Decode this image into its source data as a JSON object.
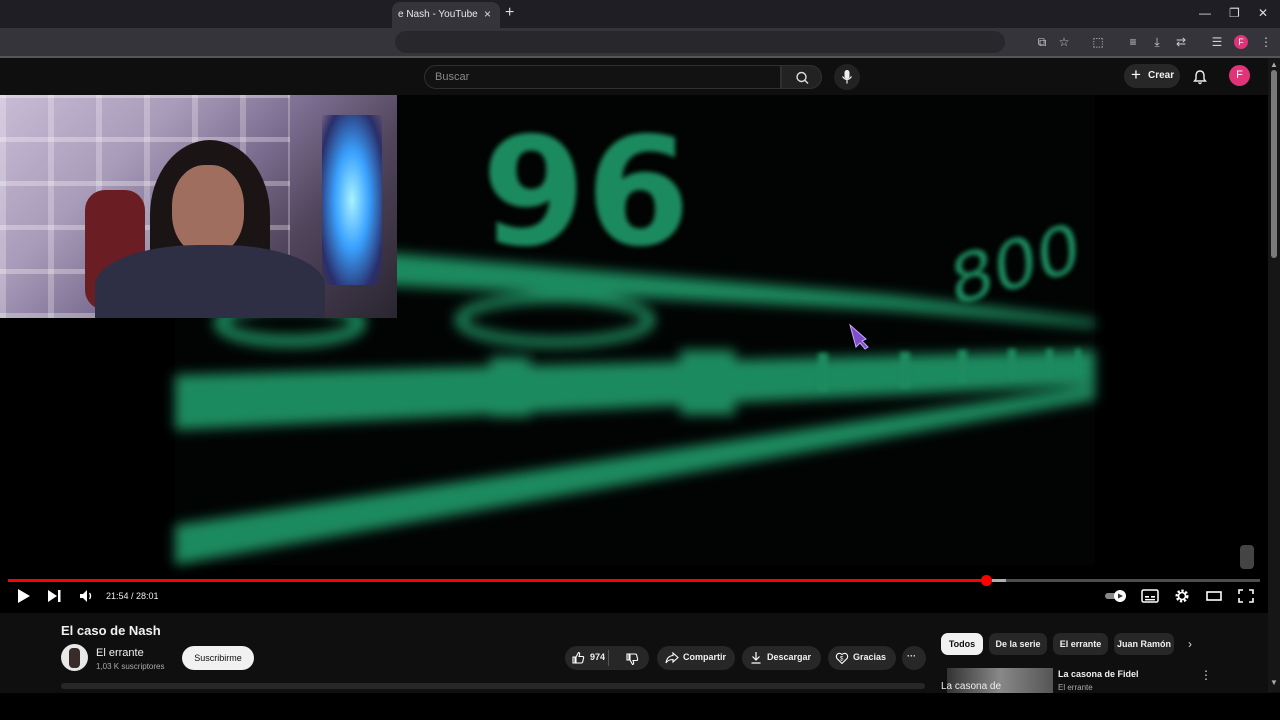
{
  "browser": {
    "tab_title": "e Nash - YouTube",
    "tab_close": "×",
    "new_tab": "+",
    "window_controls": [
      "—",
      "❐",
      "✕"
    ],
    "profile_initial": "F"
  },
  "header": {
    "search_placeholder": "Buscar",
    "create_label": "Crear",
    "avatar_initial": "F"
  },
  "player": {
    "time_current": "21:54",
    "time_total": "28:01",
    "time_display": "21:54 / 28:01",
    "progress_fraction": 0.781,
    "buffer_fraction": 0.797,
    "accent_color": "#ff0000"
  },
  "video_frame": {
    "dial_text_top": "96",
    "dial_text_bottom": "800",
    "dial_color": "#1e8a5e"
  },
  "info": {
    "title": "El caso de Nash",
    "channel_name": "El errante",
    "subscribers": "1,03 K suscriptores",
    "subscribe_label": "Suscribirme",
    "likes": "974",
    "share_label": "Compartir",
    "download_label": "Descargar",
    "thanks_label": "Gracias",
    "more_label": "···"
  },
  "sidebar": {
    "chips": [
      "Todos",
      "De la serie",
      "El errante",
      "Juan Ramón"
    ],
    "next_label": "›",
    "recommendation": {
      "thumb_text": "La casona de",
      "title": "La casona de Fidel",
      "channel": "El errante",
      "menu": "⋮"
    }
  }
}
